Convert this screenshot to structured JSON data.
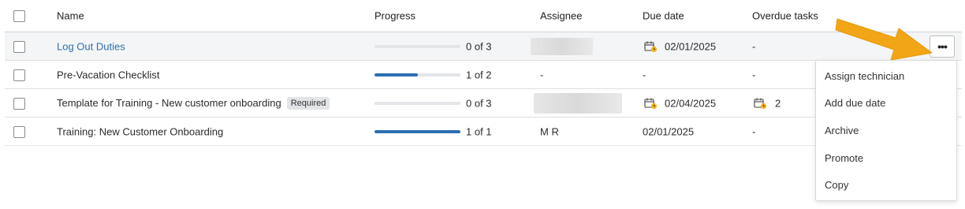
{
  "table": {
    "columns": {
      "name": "Name",
      "progress": "Progress",
      "assignee": "Assignee",
      "due_date": "Due date",
      "overdue": "Overdue tasks"
    },
    "rows": [
      {
        "name": "Log Out Duties",
        "progress_text": "0 of 3",
        "progress_fraction": 0,
        "assignee": "",
        "due_date": "02/01/2025",
        "overdue": "-"
      },
      {
        "name": "Pre-Vacation Checklist",
        "progress_text": "1 of 2",
        "progress_fraction": 0.5,
        "assignee": "-",
        "due_date": "-",
        "overdue": "-"
      },
      {
        "name": "Template for Training - New customer onboarding",
        "badge": "Required",
        "progress_text": "0 of 3",
        "progress_fraction": 0,
        "assignee": "",
        "due_date": "02/04/2025",
        "overdue": "2"
      },
      {
        "name": "Training: New Customer Onboarding",
        "progress_text": "1 of 1",
        "progress_fraction": 1,
        "assignee": "M R",
        "due_date": "02/01/2025",
        "overdue": "-"
      }
    ]
  },
  "more_button": {
    "label": "•••"
  },
  "menu": {
    "items": [
      "Assign technician",
      "Add due date",
      "Archive",
      "Promote",
      "Copy"
    ]
  },
  "colors": {
    "link": "#2f6fad",
    "progress_fill": "#2d6fb3",
    "arrow": "#f2a516",
    "calendar_badge": "#f0b31a"
  },
  "icons": {
    "calendar": "calendar-clock-icon",
    "more": "more-horizontal-icon",
    "pointer": "arrow-icon"
  }
}
